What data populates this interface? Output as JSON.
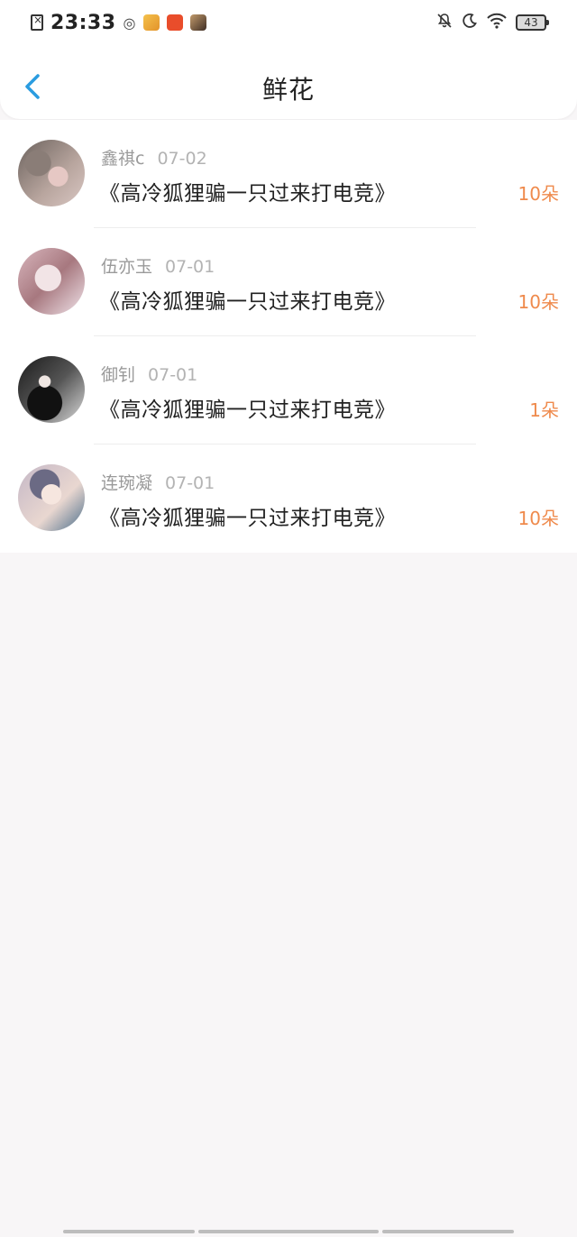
{
  "status_bar": {
    "time": "23:33",
    "battery": "43"
  },
  "header": {
    "title": "鲜花"
  },
  "items": [
    {
      "name": "鑫祺c",
      "date": "07-02",
      "book": "《高冷狐狸骗一只过来打电竞》",
      "count": "10朵"
    },
    {
      "name": "伍亦玉",
      "date": "07-01",
      "book": "《高冷狐狸骗一只过来打电竞》",
      "count": "10朵"
    },
    {
      "name": "御钊",
      "date": "07-01",
      "book": "《高冷狐狸骗一只过来打电竞》",
      "count": "1朵"
    },
    {
      "name": "连琬凝",
      "date": "07-01",
      "book": "《高冷狐狸骗一只过来打电竞》",
      "count": "10朵"
    }
  ],
  "colors": {
    "accent_back": "#2a9ce0",
    "count": "#ef8a4c",
    "background": "#f8f6f7"
  }
}
